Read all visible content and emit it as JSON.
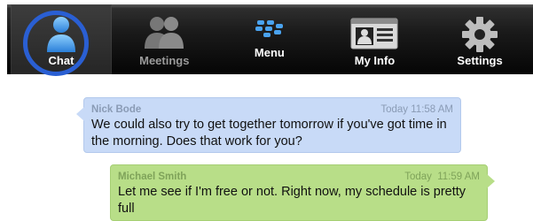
{
  "tabs": [
    {
      "label": "Chat",
      "icon": "person-icon",
      "active": true
    },
    {
      "label": "Meetings",
      "icon": "people-icon",
      "active": false
    },
    {
      "label": "Menu",
      "icon": "blackberry-logo-icon",
      "active": false
    },
    {
      "label": "My Info",
      "icon": "contact-card-icon",
      "active": false
    },
    {
      "label": "Settings",
      "icon": "gear-icon",
      "active": false
    }
  ],
  "messages": [
    {
      "sender": "Nick Bode",
      "time": "Today 11:58 AM",
      "text": "We could also try to get together tomorrow if you've got time in the morning. Does that work for you?",
      "direction": "incoming"
    },
    {
      "sender": "Michael Smith",
      "time": "Today  11:59 AM",
      "text": "Let me see if I'm free or not. Right now, my schedule is pretty full",
      "direction": "outgoing"
    }
  ],
  "colors": {
    "incoming_bubble": "#c8daf7",
    "outgoing_bubble": "#b8de88",
    "focus_ring": "#2a5fd3",
    "active_icon": "#5aa8f0"
  }
}
